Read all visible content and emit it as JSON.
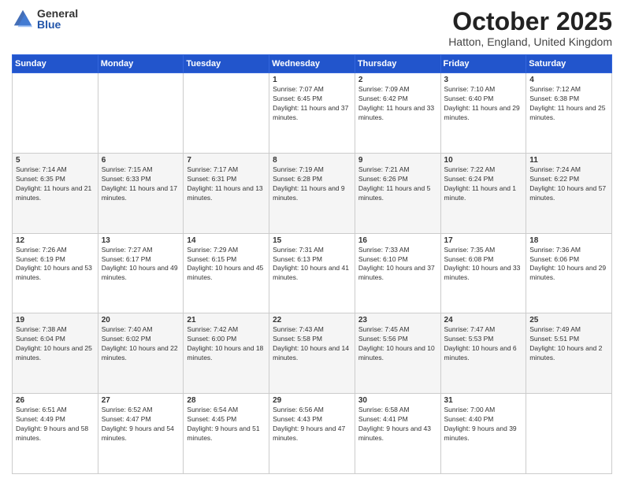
{
  "logo": {
    "general": "General",
    "blue": "Blue"
  },
  "title": "October 2025",
  "location": "Hatton, England, United Kingdom",
  "days_header": [
    "Sunday",
    "Monday",
    "Tuesday",
    "Wednesday",
    "Thursday",
    "Friday",
    "Saturday"
  ],
  "weeks": [
    [
      {
        "day": "",
        "sunrise": "",
        "sunset": "",
        "daylight": ""
      },
      {
        "day": "",
        "sunrise": "",
        "sunset": "",
        "daylight": ""
      },
      {
        "day": "",
        "sunrise": "",
        "sunset": "",
        "daylight": ""
      },
      {
        "day": "1",
        "sunrise": "Sunrise: 7:07 AM",
        "sunset": "Sunset: 6:45 PM",
        "daylight": "Daylight: 11 hours and 37 minutes."
      },
      {
        "day": "2",
        "sunrise": "Sunrise: 7:09 AM",
        "sunset": "Sunset: 6:42 PM",
        "daylight": "Daylight: 11 hours and 33 minutes."
      },
      {
        "day": "3",
        "sunrise": "Sunrise: 7:10 AM",
        "sunset": "Sunset: 6:40 PM",
        "daylight": "Daylight: 11 hours and 29 minutes."
      },
      {
        "day": "4",
        "sunrise": "Sunrise: 7:12 AM",
        "sunset": "Sunset: 6:38 PM",
        "daylight": "Daylight: 11 hours and 25 minutes."
      }
    ],
    [
      {
        "day": "5",
        "sunrise": "Sunrise: 7:14 AM",
        "sunset": "Sunset: 6:35 PM",
        "daylight": "Daylight: 11 hours and 21 minutes."
      },
      {
        "day": "6",
        "sunrise": "Sunrise: 7:15 AM",
        "sunset": "Sunset: 6:33 PM",
        "daylight": "Daylight: 11 hours and 17 minutes."
      },
      {
        "day": "7",
        "sunrise": "Sunrise: 7:17 AM",
        "sunset": "Sunset: 6:31 PM",
        "daylight": "Daylight: 11 hours and 13 minutes."
      },
      {
        "day": "8",
        "sunrise": "Sunrise: 7:19 AM",
        "sunset": "Sunset: 6:28 PM",
        "daylight": "Daylight: 11 hours and 9 minutes."
      },
      {
        "day": "9",
        "sunrise": "Sunrise: 7:21 AM",
        "sunset": "Sunset: 6:26 PM",
        "daylight": "Daylight: 11 hours and 5 minutes."
      },
      {
        "day": "10",
        "sunrise": "Sunrise: 7:22 AM",
        "sunset": "Sunset: 6:24 PM",
        "daylight": "Daylight: 11 hours and 1 minute."
      },
      {
        "day": "11",
        "sunrise": "Sunrise: 7:24 AM",
        "sunset": "Sunset: 6:22 PM",
        "daylight": "Daylight: 10 hours and 57 minutes."
      }
    ],
    [
      {
        "day": "12",
        "sunrise": "Sunrise: 7:26 AM",
        "sunset": "Sunset: 6:19 PM",
        "daylight": "Daylight: 10 hours and 53 minutes."
      },
      {
        "day": "13",
        "sunrise": "Sunrise: 7:27 AM",
        "sunset": "Sunset: 6:17 PM",
        "daylight": "Daylight: 10 hours and 49 minutes."
      },
      {
        "day": "14",
        "sunrise": "Sunrise: 7:29 AM",
        "sunset": "Sunset: 6:15 PM",
        "daylight": "Daylight: 10 hours and 45 minutes."
      },
      {
        "day": "15",
        "sunrise": "Sunrise: 7:31 AM",
        "sunset": "Sunset: 6:13 PM",
        "daylight": "Daylight: 10 hours and 41 minutes."
      },
      {
        "day": "16",
        "sunrise": "Sunrise: 7:33 AM",
        "sunset": "Sunset: 6:10 PM",
        "daylight": "Daylight: 10 hours and 37 minutes."
      },
      {
        "day": "17",
        "sunrise": "Sunrise: 7:35 AM",
        "sunset": "Sunset: 6:08 PM",
        "daylight": "Daylight: 10 hours and 33 minutes."
      },
      {
        "day": "18",
        "sunrise": "Sunrise: 7:36 AM",
        "sunset": "Sunset: 6:06 PM",
        "daylight": "Daylight: 10 hours and 29 minutes."
      }
    ],
    [
      {
        "day": "19",
        "sunrise": "Sunrise: 7:38 AM",
        "sunset": "Sunset: 6:04 PM",
        "daylight": "Daylight: 10 hours and 25 minutes."
      },
      {
        "day": "20",
        "sunrise": "Sunrise: 7:40 AM",
        "sunset": "Sunset: 6:02 PM",
        "daylight": "Daylight: 10 hours and 22 minutes."
      },
      {
        "day": "21",
        "sunrise": "Sunrise: 7:42 AM",
        "sunset": "Sunset: 6:00 PM",
        "daylight": "Daylight: 10 hours and 18 minutes."
      },
      {
        "day": "22",
        "sunrise": "Sunrise: 7:43 AM",
        "sunset": "Sunset: 5:58 PM",
        "daylight": "Daylight: 10 hours and 14 minutes."
      },
      {
        "day": "23",
        "sunrise": "Sunrise: 7:45 AM",
        "sunset": "Sunset: 5:56 PM",
        "daylight": "Daylight: 10 hours and 10 minutes."
      },
      {
        "day": "24",
        "sunrise": "Sunrise: 7:47 AM",
        "sunset": "Sunset: 5:53 PM",
        "daylight": "Daylight: 10 hours and 6 minutes."
      },
      {
        "day": "25",
        "sunrise": "Sunrise: 7:49 AM",
        "sunset": "Sunset: 5:51 PM",
        "daylight": "Daylight: 10 hours and 2 minutes."
      }
    ],
    [
      {
        "day": "26",
        "sunrise": "Sunrise: 6:51 AM",
        "sunset": "Sunset: 4:49 PM",
        "daylight": "Daylight: 9 hours and 58 minutes."
      },
      {
        "day": "27",
        "sunrise": "Sunrise: 6:52 AM",
        "sunset": "Sunset: 4:47 PM",
        "daylight": "Daylight: 9 hours and 54 minutes."
      },
      {
        "day": "28",
        "sunrise": "Sunrise: 6:54 AM",
        "sunset": "Sunset: 4:45 PM",
        "daylight": "Daylight: 9 hours and 51 minutes."
      },
      {
        "day": "29",
        "sunrise": "Sunrise: 6:56 AM",
        "sunset": "Sunset: 4:43 PM",
        "daylight": "Daylight: 9 hours and 47 minutes."
      },
      {
        "day": "30",
        "sunrise": "Sunrise: 6:58 AM",
        "sunset": "Sunset: 4:41 PM",
        "daylight": "Daylight: 9 hours and 43 minutes."
      },
      {
        "day": "31",
        "sunrise": "Sunrise: 7:00 AM",
        "sunset": "Sunset: 4:40 PM",
        "daylight": "Daylight: 9 hours and 39 minutes."
      },
      {
        "day": "",
        "sunrise": "",
        "sunset": "",
        "daylight": ""
      }
    ]
  ]
}
